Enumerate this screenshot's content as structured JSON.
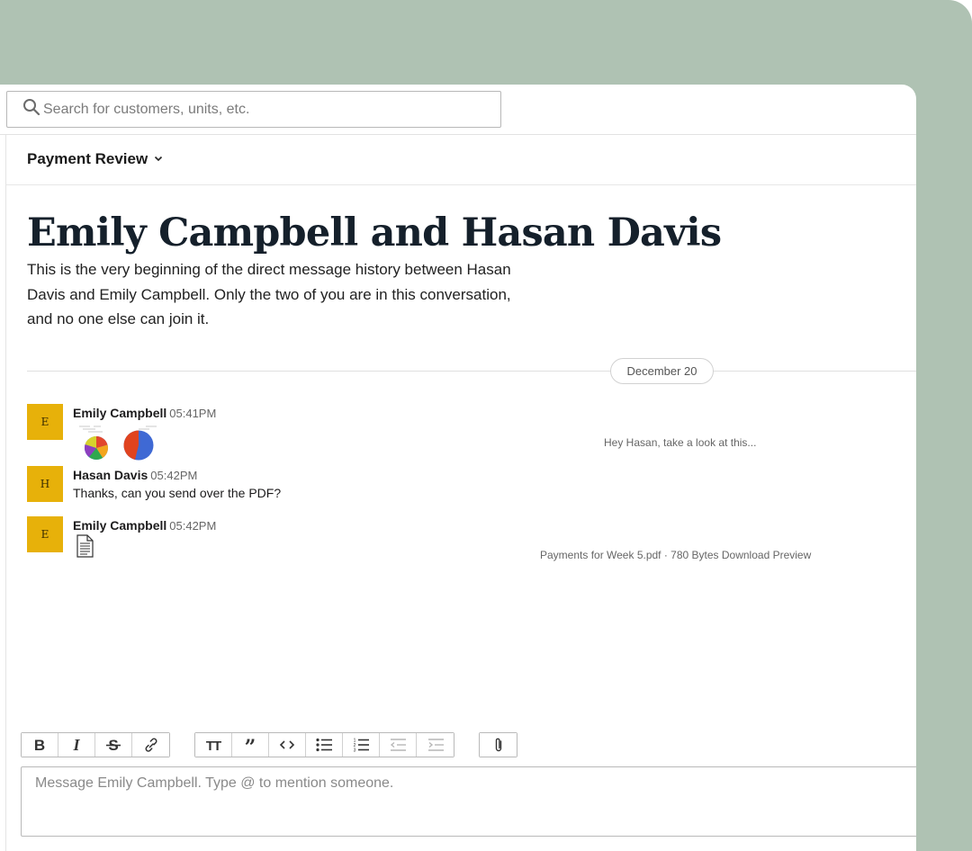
{
  "search": {
    "placeholder": "Search for customers, units, etc."
  },
  "header": {
    "channel_name": "Payment Review"
  },
  "conversation": {
    "title": "Emily Campbell and Hasan Davis",
    "intro": "This is the very beginning of the direct message history between Hasan Davis and Emily Campbell. Only the two of you are in this conversation, and no one else can join it.",
    "date_label": "December 20"
  },
  "messages": [
    {
      "initial": "E",
      "author": "Emily Campbell",
      "time": "05:41PM",
      "attachment_caption": "Hey Hasan, take a look at this..."
    },
    {
      "initial": "H",
      "author": "Hasan Davis",
      "time": "05:42PM",
      "text": "Thanks, can you send over the PDF?"
    },
    {
      "initial": "E",
      "author": "Emily Campbell",
      "time": "05:42PM",
      "attachment_caption": "Payments for Week 5.pdf · 780 Bytes Download Preview"
    }
  ],
  "toolbar": {
    "buttons": [
      "bold-icon",
      "italic-icon",
      "strikethrough-icon",
      "link-icon",
      "text-size-icon",
      "quote-icon",
      "code-icon",
      "bullet-list-icon",
      "numbered-list-icon",
      "outdent-icon",
      "indent-icon",
      "attachment-icon"
    ]
  },
  "composer": {
    "placeholder": "Message Emily Campbell. Type @ to mention someone."
  },
  "colors": {
    "background": "#afc2b3",
    "avatar": "#e7b10a",
    "text": "#1d1c1d"
  }
}
